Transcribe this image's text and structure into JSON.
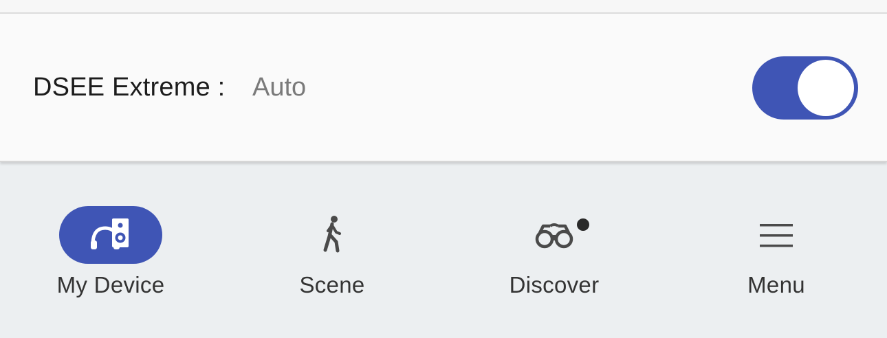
{
  "setting": {
    "label": "DSEE Extreme :",
    "value": "Auto",
    "toggle_on": true
  },
  "nav": {
    "items": [
      {
        "label": "My Device",
        "icon": "headphones-speaker-icon",
        "active": true
      },
      {
        "label": "Scene",
        "icon": "walking-person-icon",
        "active": false
      },
      {
        "label": "Discover",
        "icon": "binoculars-icon",
        "active": false,
        "notification": true
      },
      {
        "label": "Menu",
        "icon": "hamburger-menu-icon",
        "active": false
      }
    ]
  },
  "colors": {
    "accent": "#3f55b5",
    "nav_background": "#eceff1",
    "card_background": "#fafafa",
    "label_text": "#1c1c1c",
    "value_text": "#7a7a7a"
  }
}
